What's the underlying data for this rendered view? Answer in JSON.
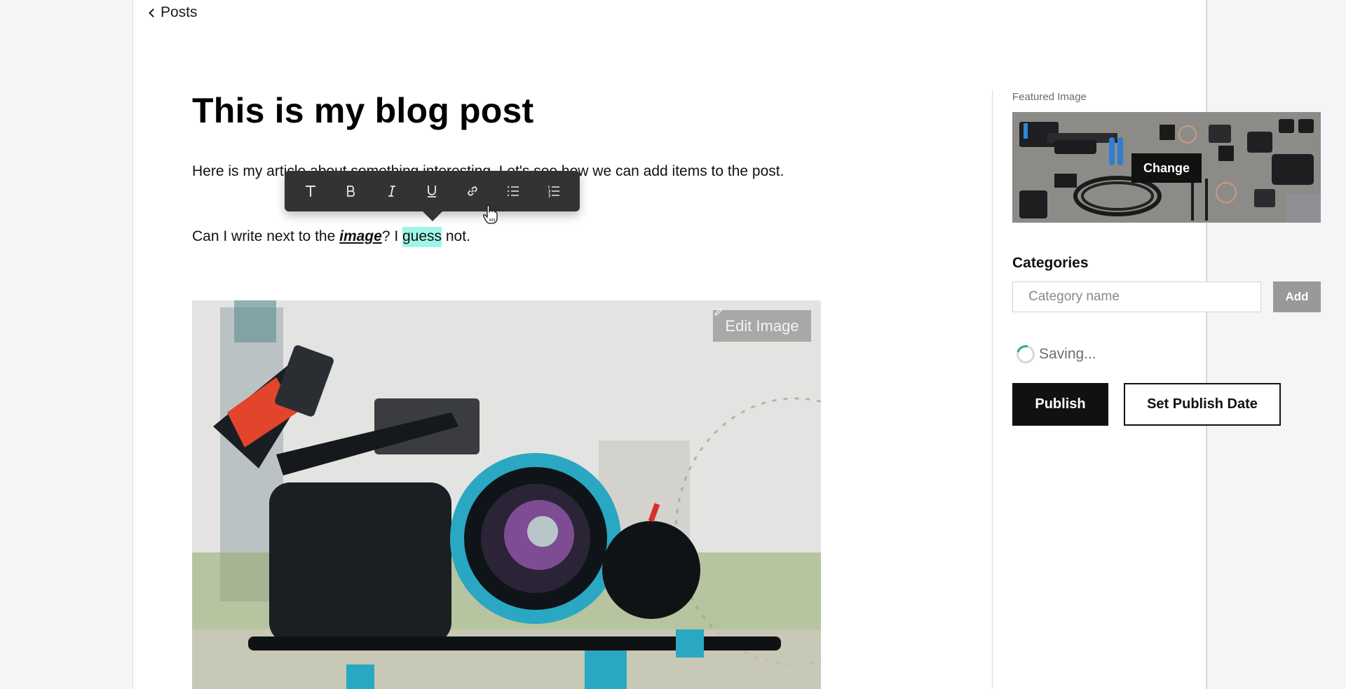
{
  "nav": {
    "back_label": "Posts",
    "back_icon": "chevron-left-icon"
  },
  "editor": {
    "title": "This is my blog post",
    "paragraph1": "Here is my article about something interesting. Let's see how we can add items to the post.",
    "paragraph2": {
      "before": "Can I write next to the ",
      "emphasis": "image",
      "middle": "? I ",
      "highlighted": "guess",
      "after": " not."
    },
    "highlight_color": "#9ff5e8",
    "format_toolbar": {
      "buttons": [
        {
          "name": "text-style",
          "icon": "text-icon"
        },
        {
          "name": "bold",
          "icon": "bold-icon"
        },
        {
          "name": "italic",
          "icon": "italic-icon"
        },
        {
          "name": "underline",
          "icon": "underline-icon"
        },
        {
          "name": "link",
          "icon": "link-icon"
        },
        {
          "name": "bulleted-list",
          "icon": "bulleted-list-icon"
        },
        {
          "name": "numbered-list",
          "icon": "numbered-list-icon"
        }
      ]
    },
    "content_image": {
      "alt": "Cinema camera with blue focus ring in front of a city and Ferris wheel",
      "edit_label": "Edit Image"
    }
  },
  "sidebar": {
    "featured_image_label": "Featured Image",
    "featured_image_alt": "Flat-lay of camera gear on concrete",
    "change_label": "Change",
    "categories_label": "Categories",
    "category_input": {
      "placeholder": "Category name",
      "value": ""
    },
    "add_label": "Add",
    "status_text": "Saving...",
    "publish_label": "Publish",
    "set_publish_date_label": "Set Publish Date"
  },
  "colors": {
    "page_background": "#f4f5f7",
    "toolbar_background": "#333333",
    "primary_button": "#111111",
    "add_button": "#999999",
    "spinner_accent": "#2aa88e"
  }
}
